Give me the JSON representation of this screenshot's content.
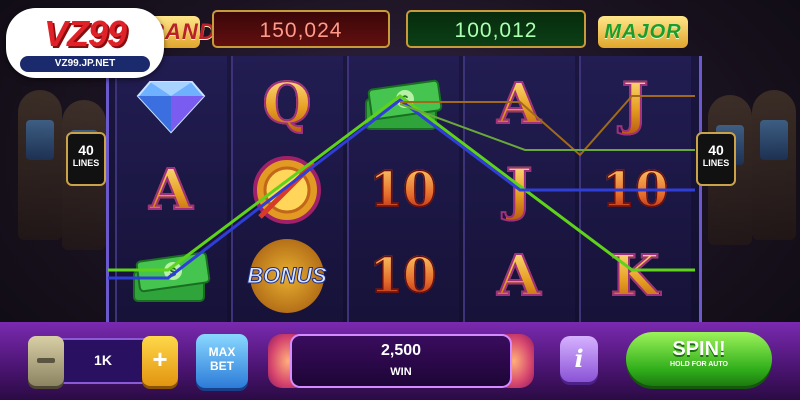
{
  "logo": {
    "mark": "VZ99",
    "url": "VZ99.JP.NET"
  },
  "jackpots": {
    "grand_label": "GRAND",
    "grand_value": "150,024",
    "major_value": "100,012",
    "major_label": "MAJOR"
  },
  "lines": {
    "left_count": "40",
    "left_text": "LINES",
    "right_count": "40",
    "right_text": "LINES"
  },
  "reels": [
    [
      "diamond",
      "A",
      "cash"
    ],
    [
      "Q",
      "wild",
      "BONUS"
    ],
    [
      "cash",
      "10",
      "10"
    ],
    [
      "A",
      "J",
      "A"
    ],
    [
      "J",
      "10",
      "K"
    ]
  ],
  "symbol_labels": {
    "bonus": "BONUS"
  },
  "paylines": [
    {
      "color": "#5fd21a"
    },
    {
      "color": "#2f3ed6"
    },
    {
      "color": "#a06a1a"
    },
    {
      "color": "#6aa83a"
    }
  ],
  "controls": {
    "bet_value": "1K",
    "plus_label": "+",
    "maxbet_line1": "MAX",
    "maxbet_line2": "BET",
    "win_value": "2,500",
    "win_label": "WIN",
    "info_label": "i",
    "spin_label": "SPIN!",
    "spin_sub": "HOLD FOR AUTO"
  },
  "colors": {
    "accent_purple": "#7a2ab0",
    "spin_green": "#2fae1a",
    "frame_gold": "#caa24a"
  }
}
